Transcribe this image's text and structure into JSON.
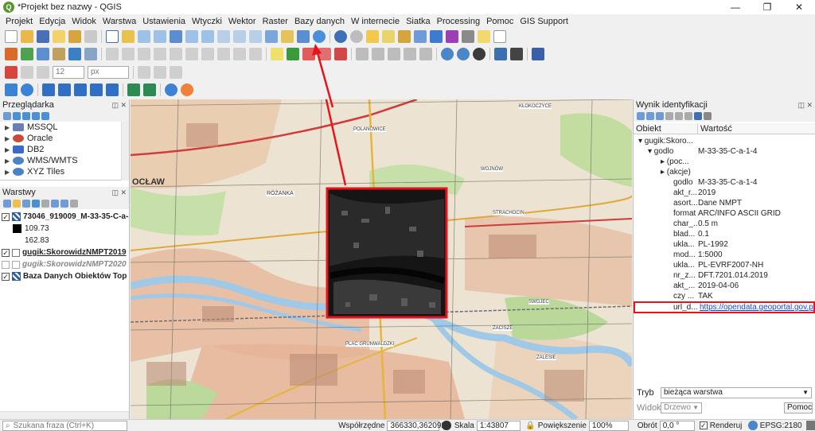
{
  "window": {
    "title": "*Projekt bez nazwy - QGIS",
    "logo_letter": "Q",
    "minimize": "—",
    "maximize": "❐",
    "close": "✕"
  },
  "menu": [
    "Projekt",
    "Edycja",
    "Widok",
    "Warstwa",
    "Ustawienia",
    "Wtyczki",
    "Wektor",
    "Raster",
    "Bazy danych",
    "W internecie",
    "Siatka",
    "Processing",
    "Pomoc",
    "GIS Support"
  ],
  "toolbar": {
    "font_size": "12",
    "unit": "px"
  },
  "browser_panel": {
    "title": "Przeglądarka",
    "items": [
      {
        "label": "MSSQL",
        "color": "#6a7fb5"
      },
      {
        "label": "Oracle",
        "color": "#c94b3a"
      },
      {
        "label": "DB2",
        "color": "#3a6bc9"
      },
      {
        "label": "WMS/WMTS",
        "color": "#4a82c2"
      },
      {
        "label": "XYZ Tiles",
        "color": "#4a82c2"
      }
    ]
  },
  "layers_panel": {
    "title": "Warstwy",
    "layers": [
      {
        "name": "73046_919009_M-33-35-C-a-",
        "checked": true,
        "style": "bold"
      },
      {
        "name": "109.73",
        "checked": false,
        "style": "legend-dark"
      },
      {
        "name": "162.83",
        "checked": false,
        "style": "legend-plain"
      },
      {
        "name": "gugik:SkorowidzNMPT2019",
        "checked": true,
        "style": "bold-underline"
      },
      {
        "name": "gugik:SkorowidzNMPT2020",
        "checked": false,
        "style": "italic-grey"
      },
      {
        "name": "Baza Danych Obiektów Top",
        "checked": true,
        "style": "bold"
      }
    ]
  },
  "map": {
    "labels": [
      {
        "text": "OCŁAW"
      },
      {
        "text": "RÓŻANKA"
      },
      {
        "text": "KŁOKOCZYCE"
      },
      {
        "text": "SWOJEC"
      },
      {
        "text": "ZALESIE"
      },
      {
        "text": "PLAC GRUNWALDZKI"
      },
      {
        "text": "ZACISZE"
      },
      {
        "text": "POLANOWICE"
      },
      {
        "text": "WOJNÓW"
      },
      {
        "text": "STRACHOCIN"
      }
    ]
  },
  "identify_panel": {
    "title": "Wynik identyfikacji",
    "col_object": "Obiekt",
    "col_value": "Wartość",
    "rows": [
      {
        "key": "▾ gugik:Skoro...",
        "value": "",
        "indent": 0
      },
      {
        "key": "▾ godlo",
        "value": "M-33-35-C-a-1-4",
        "indent": 1
      },
      {
        "key": "▸ (poc...",
        "value": "",
        "indent": 2
      },
      {
        "key": "▸ (akcje)",
        "value": "",
        "indent": 2
      },
      {
        "key": "godlo",
        "value": "M-33-35-C-a-1-4",
        "indent": 3
      },
      {
        "key": "akt_r...",
        "value": "2019",
        "indent": 3
      },
      {
        "key": "asort...",
        "value": "Dane NMPT",
        "indent": 3
      },
      {
        "key": "format",
        "value": "ARC/INFO ASCII GRID",
        "indent": 3
      },
      {
        "key": "char_...",
        "value": "0.5 m",
        "indent": 3
      },
      {
        "key": "blad...",
        "value": "0.1",
        "indent": 3
      },
      {
        "key": "ukla...",
        "value": "PL-1992",
        "indent": 3
      },
      {
        "key": "mod...",
        "value": "1:5000",
        "indent": 3
      },
      {
        "key": "ukla...",
        "value": "PL-EVRF2007-NH",
        "indent": 3
      },
      {
        "key": "nr_z...",
        "value": "DFT.7201.014.2019",
        "indent": 3
      },
      {
        "key": "akt_...",
        "value": "2019-04-06",
        "indent": 3
      },
      {
        "key": "czy ...",
        "value": "TAK",
        "indent": 3
      },
      {
        "key": "url_d...",
        "value": "https://opendata.geoportal.gov.p",
        "indent": 3,
        "link": true
      }
    ],
    "mode_label": "Tryb",
    "mode_value": "bieżąca warstwa",
    "view_label": "Widok",
    "view_value": "Drzewo",
    "help_button": "Pomoc"
  },
  "statusbar": {
    "search_placeholder": "Szukana fraza (Ctrl+K)",
    "coords_label": "Współrzędne",
    "coords_value": "366330,362092",
    "scale_label": "Skala",
    "scale_value": "1:43807",
    "zoom_label": "Powiększenie",
    "zoom_value": "100%",
    "rotation_label": "Obrót",
    "rotation_value": "0,0 °",
    "render_label": "Renderuj",
    "crs_label": "EPSG:2180"
  },
  "colors": {
    "highlight": "#e8141b",
    "link": "#1a44d6",
    "qgis_green": "#589632"
  }
}
